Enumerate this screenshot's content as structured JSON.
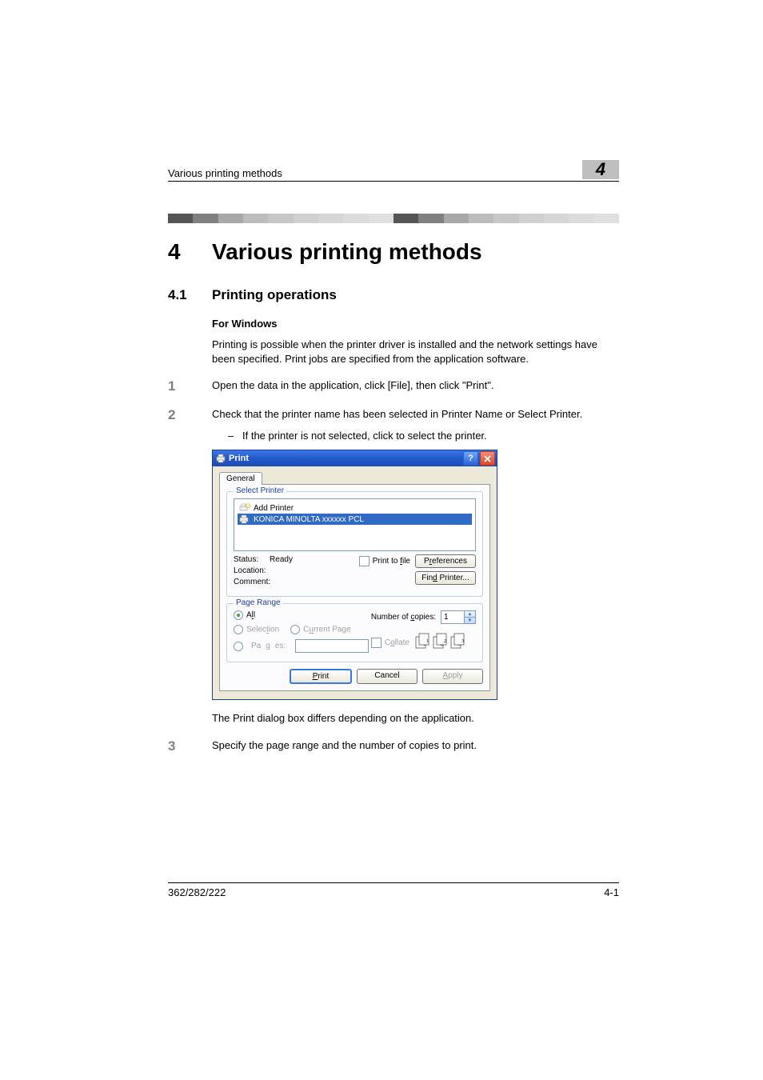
{
  "header": {
    "running_title": "Various printing methods",
    "badge": "4"
  },
  "chapter": {
    "number": "4",
    "title": "Various printing methods"
  },
  "section": {
    "number": "4.1",
    "title": "Printing operations"
  },
  "subheading": "For Windows",
  "intro": "Printing is possible when the printer driver is installed and the network settings have been specified. Print jobs are specified from the application software.",
  "steps": {
    "s1": {
      "n": "1",
      "text": "Open the data in the application, click [File], then click \"Print\"."
    },
    "s2": {
      "n": "2",
      "text": "Check that the printer name has been selected in Printer Name or Select Printer.",
      "bullet": "If the printer is not selected, click to select the printer."
    },
    "after_dialog": "The Print dialog box differs depending on the application.",
    "s3": {
      "n": "3",
      "text": "Specify the page range and the number of copies to print."
    }
  },
  "dialog": {
    "title": "Print",
    "tabs": {
      "general": "General"
    },
    "select_printer_legend": "Select Printer",
    "printers": {
      "add": "Add Printer",
      "selected": "KONICA MINOLTA xxxxxx PCL"
    },
    "status_label": "Status:",
    "status_value": "Ready",
    "location_label": "Location:",
    "comment_label": "Comment:",
    "print_to_file": "Print to file",
    "preferences": "Preferences",
    "find_printer": "Find Printer...",
    "page_range_legend": "Page Range",
    "all": "All",
    "selection": "Selection",
    "current_page": "Current Page",
    "pages": "Pages:",
    "num_copies_label": "Number of copies:",
    "num_copies_value": "1",
    "collate": "Collate",
    "btn_print": "Print",
    "btn_cancel": "Cancel",
    "btn_apply": "Apply"
  },
  "footer": {
    "left": "362/282/222",
    "right": "4-1"
  },
  "stripe_colors": [
    "#555555",
    "#808080",
    "#a8a8a8",
    "#bdbdbd",
    "#c7c7c7",
    "#d0d0d0",
    "#d6d6d6",
    "#dcdcdc",
    "#e0e0e0",
    "#555555",
    "#808080",
    "#a8a8a8",
    "#bdbdbd",
    "#c7c7c7",
    "#d0d0d0",
    "#d6d6d6",
    "#dcdcdc",
    "#e0e0e0"
  ]
}
